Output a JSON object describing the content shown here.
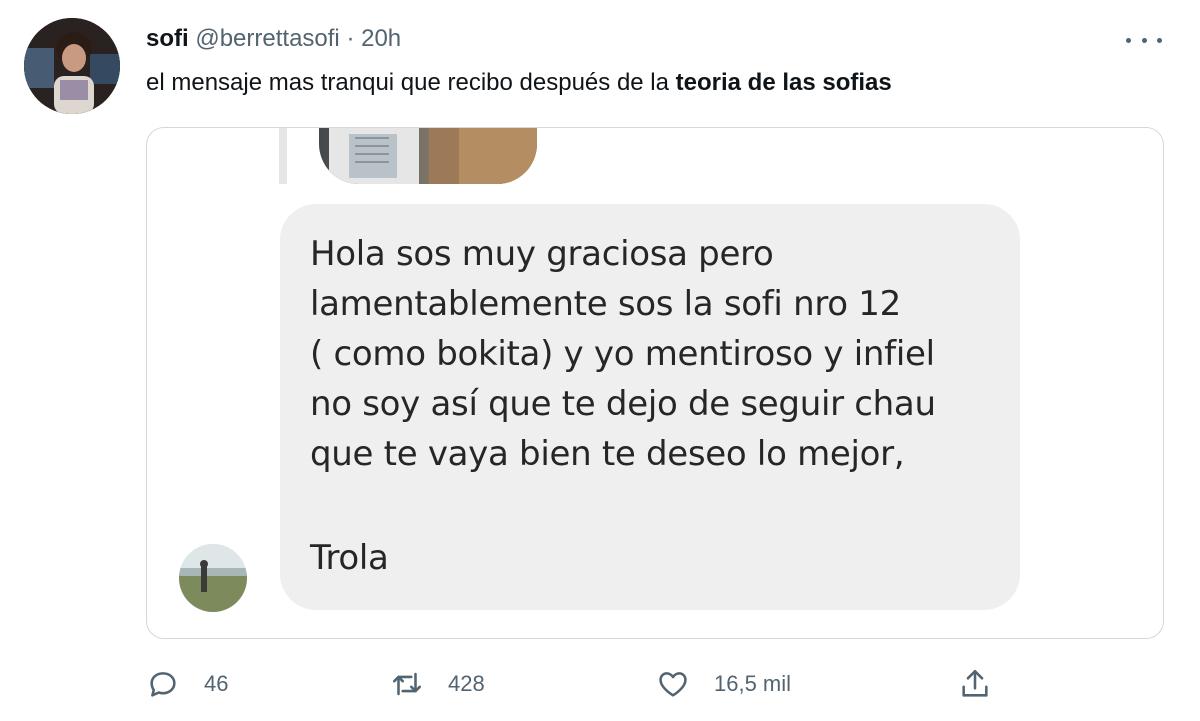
{
  "author": {
    "name": "sofi",
    "handle": "@berrettasofi",
    "separator": "·",
    "time": "20h"
  },
  "tweet": {
    "text_plain": "el mensaje mas tranqui que recibo después de la ",
    "text_bold": "teoria de las sofias"
  },
  "media": {
    "message_lines": [
      "Hola sos muy graciosa pero",
      "lamentablemente sos la sofi nro 12",
      "( como bokita) y yo mentiroso y infiel",
      "no soy así que te dejo de seguir chau",
      "que te vaya bien te deseo lo mejor,",
      "Trola"
    ]
  },
  "actions": {
    "reply_count": "46",
    "retweet_count": "428",
    "like_count": "16,5 mil"
  },
  "icons": {
    "more": "more-horizontal-icon",
    "reply": "reply-icon",
    "retweet": "retweet-icon",
    "like": "heart-icon",
    "share": "share-icon"
  },
  "colors": {
    "text": "#0f1419",
    "secondary": "#536471",
    "bubble": "#efefef",
    "border": "#cfd9de"
  }
}
